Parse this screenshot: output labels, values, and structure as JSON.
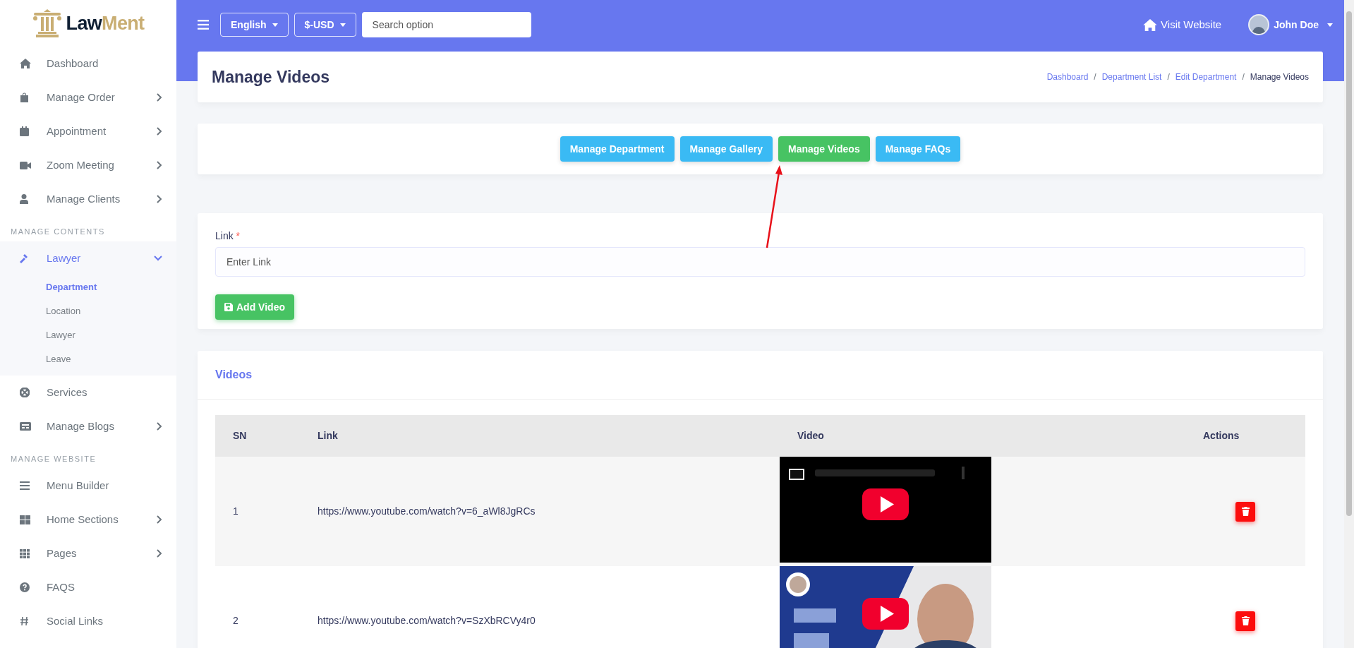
{
  "brand": {
    "part_1": "Law",
    "part_2": "Ment"
  },
  "sidebar": {
    "items": [
      {
        "kind": "item",
        "label": "Dashboard",
        "has_submenu": false
      },
      {
        "kind": "item",
        "label": "Manage Order",
        "has_submenu": true
      },
      {
        "kind": "item",
        "label": "Appointment",
        "has_submenu": true
      },
      {
        "kind": "item",
        "label": "Zoom Meeting",
        "has_submenu": true
      },
      {
        "kind": "item",
        "label": "Manage Clients",
        "has_submenu": true
      },
      {
        "kind": "section",
        "label": "MANAGE CONTENTS"
      },
      {
        "kind": "group",
        "label": "Lawyer",
        "expanded": true,
        "children": [
          {
            "label": "Department",
            "selected": true
          },
          {
            "label": "Location",
            "selected": false
          },
          {
            "label": "Lawyer",
            "selected": false
          },
          {
            "label": "Leave",
            "selected": false
          }
        ]
      },
      {
        "kind": "item",
        "label": "Services",
        "has_submenu": false
      },
      {
        "kind": "item",
        "label": "Manage Blogs",
        "has_submenu": true
      },
      {
        "kind": "section",
        "label": "MANAGE WEBSITE"
      },
      {
        "kind": "item",
        "label": "Menu Builder",
        "has_submenu": false
      },
      {
        "kind": "item",
        "label": "Home Sections",
        "has_submenu": true
      },
      {
        "kind": "item",
        "label": "Pages",
        "has_submenu": true
      },
      {
        "kind": "item",
        "label": "FAQS",
        "has_submenu": false
      },
      {
        "kind": "item",
        "label": "Social Links",
        "has_submenu": false
      }
    ]
  },
  "topbar": {
    "language": "English",
    "currency": "$-USD",
    "search": {
      "placeholder": "Search option"
    },
    "visit_website": "Visit Website",
    "user": "John Doe"
  },
  "page": {
    "title": "Manage Videos",
    "breadcrumb_separator": "/",
    "breadcrumb": [
      "Dashboard",
      "Department List",
      "Edit Department",
      "Manage Videos"
    ]
  },
  "tabs": [
    {
      "label": "Manage Department",
      "selected": false
    },
    {
      "label": "Manage Gallery",
      "selected": false
    },
    {
      "label": "Manage Videos",
      "selected": true
    },
    {
      "label": "Manage FAQs",
      "selected": false
    }
  ],
  "form": {
    "label": "Link",
    "required_mark": "*",
    "placeholder": "Enter Link",
    "button": "Add Video"
  },
  "videos": {
    "title": "Videos",
    "columns": [
      "SN",
      "Link",
      "Video",
      "Actions"
    ],
    "rows": [
      {
        "sn": "1",
        "link": "https://www.youtube.com/watch?v=6_aWl8JgRCs"
      },
      {
        "sn": "2",
        "link": "https://www.youtube.com/watch?v=SzXbRCVy4r0"
      }
    ]
  }
}
